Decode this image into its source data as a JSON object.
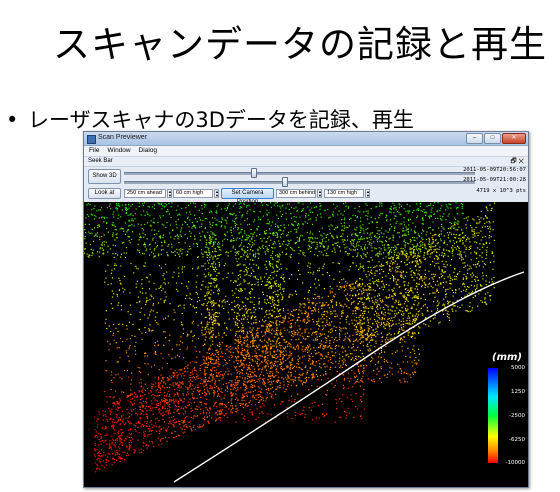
{
  "slide": {
    "title": "スキャンデータの記録と再生",
    "bullet_marker": "•",
    "bullet": "レーザスキャナの3Dデータを記録、再生"
  },
  "window": {
    "title": "Scan Previewer",
    "controls": {
      "minimize": "–",
      "maximize": "□",
      "close": "✕"
    }
  },
  "menu": {
    "items": [
      "File",
      "Window",
      "Dialog"
    ]
  },
  "seek_bar": {
    "label": "Seek Bar",
    "icons": "🗗 ✕"
  },
  "controls": {
    "show3d_label": "Show 3D",
    "lookat_label": "Look at",
    "set_camera_label": "Set Camera Position",
    "ahead": "250 cm ahead",
    "high1": "60 cm high",
    "behind": "300 cm behind",
    "high2": "130 cm high",
    "time_start": "2011-05-09T20:56:07",
    "time_current": "2011-05-09T21:00:28",
    "point_count": "4719 x 10^3 pts"
  },
  "colorbar": {
    "unit": "(mm)",
    "ticks": [
      "5000",
      "1250",
      "-2500",
      "-6250",
      "-10000"
    ],
    "colors": [
      "#0000ff",
      "#00e5ff",
      "#00ff40",
      "#ffff00",
      "#ff8000",
      "#ff0000"
    ]
  },
  "colors": {
    "title_bar": "#a9c3e3",
    "panel": "#e3eaf4",
    "viewport": "#000000"
  }
}
